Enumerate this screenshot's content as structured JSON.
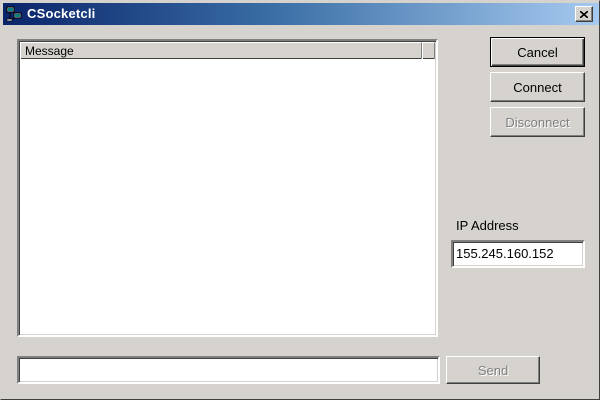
{
  "window": {
    "title": "CSocketcli",
    "app_icon": "network-computers-icon",
    "close_icon": "close-icon"
  },
  "message_list": {
    "column_header": "Message",
    "items": []
  },
  "buttons": {
    "cancel": "Cancel",
    "connect": "Connect",
    "disconnect": "Disconnect",
    "send": "Send"
  },
  "ip": {
    "label": "IP Address",
    "value": "155.245.160.152"
  },
  "send_input": {
    "value": ""
  }
}
